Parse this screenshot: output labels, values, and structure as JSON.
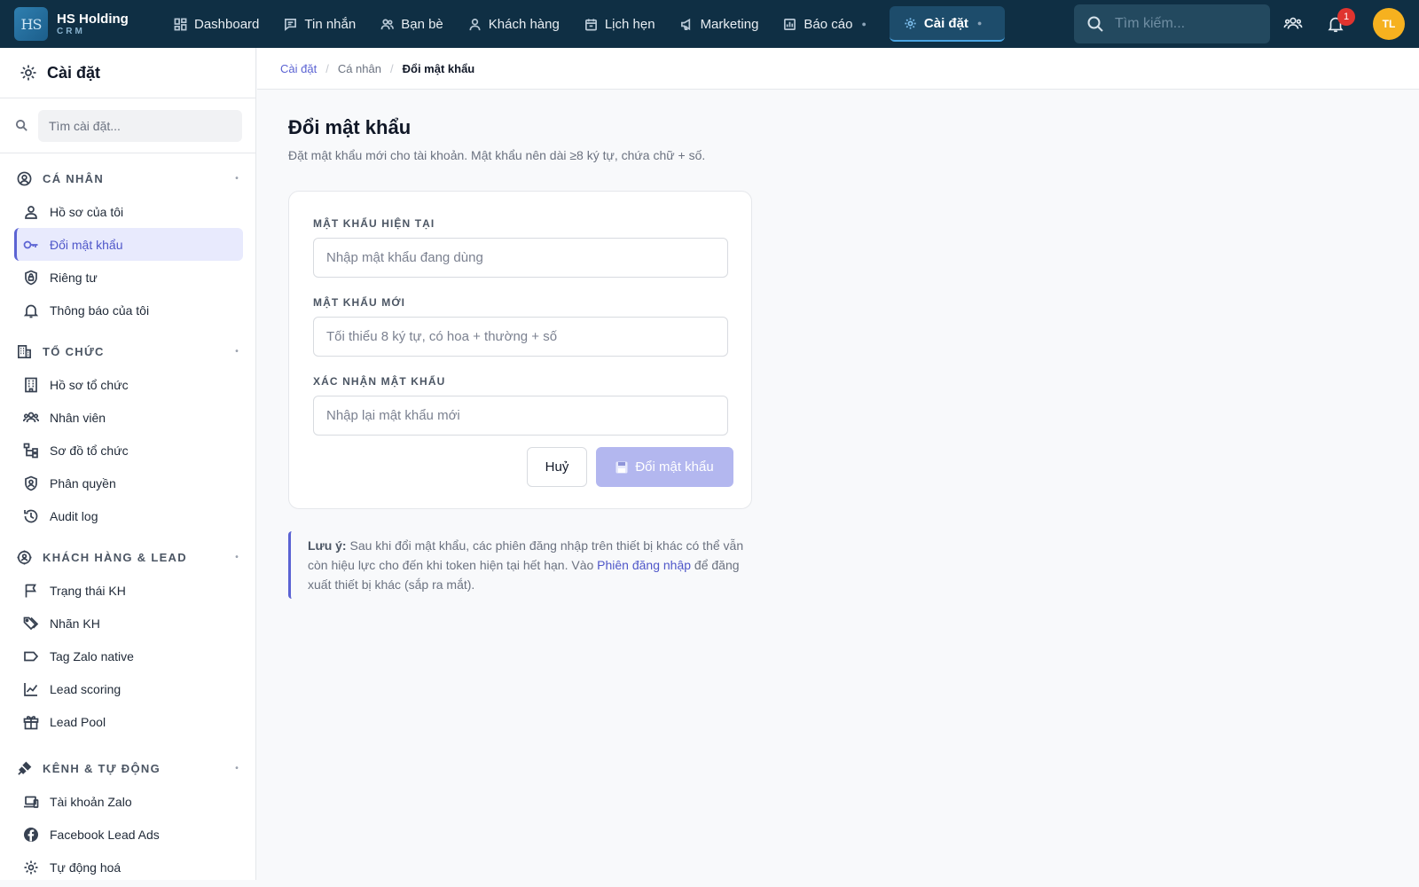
{
  "brand": {
    "logo": "HS",
    "name": "HS Holding",
    "sub": "CRM"
  },
  "nav": [
    {
      "label": "Dashboard",
      "icon": "dashboard-icon"
    },
    {
      "label": "Tin nhắn",
      "icon": "message-icon"
    },
    {
      "label": "Bạn bè",
      "icon": "friends-icon"
    },
    {
      "label": "Khách hàng",
      "icon": "customer-icon"
    },
    {
      "label": "Lịch hẹn",
      "icon": "calendar-icon"
    },
    {
      "label": "Marketing",
      "icon": "megaphone-icon"
    },
    {
      "label": "Báo cáo",
      "icon": "report-icon"
    },
    {
      "label": "Cài đặt",
      "icon": "gear-icon",
      "active": true
    }
  ],
  "search": {
    "placeholder": "Tìm kiếm..."
  },
  "notifications": {
    "count": "1"
  },
  "user": {
    "initials": "TL"
  },
  "colors": {
    "topbar": "#0f2f44",
    "accent": "#5b63d3",
    "avatar": "#f6b11f",
    "badge": "#e0342f"
  },
  "sidebar": {
    "title": "Cài đặt",
    "search_placeholder": "Tìm cài đặt...",
    "groups": [
      {
        "title": "CÁ NHÂN",
        "items": [
          {
            "label": "Hồ sơ của tôi"
          },
          {
            "label": "Đổi mật khẩu",
            "active": true
          },
          {
            "label": "Riêng tư"
          },
          {
            "label": "Thông báo của tôi"
          }
        ]
      },
      {
        "title": "TỔ CHỨC",
        "items": [
          {
            "label": "Hồ sơ tổ chức"
          },
          {
            "label": "Nhân viên"
          },
          {
            "label": "Sơ đồ tổ chức"
          },
          {
            "label": "Phân quyền"
          },
          {
            "label": "Audit log"
          }
        ]
      },
      {
        "title": "KHÁCH HÀNG & LEAD",
        "items": [
          {
            "label": "Trạng thái KH"
          },
          {
            "label": "Nhãn KH"
          },
          {
            "label": "Tag Zalo native"
          },
          {
            "label": "Lead scoring"
          },
          {
            "label": "Lead Pool"
          }
        ]
      },
      {
        "title": "KÊNH & TỰ ĐỘNG",
        "items": [
          {
            "label": "Tài khoản Zalo"
          },
          {
            "label": "Facebook Lead Ads"
          },
          {
            "label": "Tự động hoá"
          }
        ]
      }
    ]
  },
  "breadcrumb": {
    "root": "Cài đặt",
    "section": "Cá nhân",
    "current": "Đổi mật khẩu"
  },
  "page": {
    "title": "Đổi mật khẩu",
    "description": "Đặt mật khẩu mới cho tài khoản. Mật khẩu nên dài ≥8 ký tự, chứa chữ + số."
  },
  "form": {
    "current_label": "MẬT KHẨU HIỆN TẠI",
    "current_placeholder": "Nhập mật khẩu đang dùng",
    "new_label": "MẬT KHẨU MỚI",
    "new_placeholder": "Tối thiểu 8 ký tự, có hoa + thường + số",
    "confirm_label": "XÁC NHẬN MẬT KHẨU",
    "confirm_placeholder": "Nhập lại mật khẩu mới",
    "cancel_label": "Huỷ",
    "submit_label": "Đổi mật khẩu"
  },
  "note": {
    "prefix": "Lưu ý:",
    "text_before": " Sau khi đổi mật khẩu, các phiên đăng nhập trên thiết bị khác có thể vẫn còn hiệu lực cho đến khi token hiện tại hết hạn. Vào ",
    "link": "Phiên đăng nhập",
    "text_after": " để đăng xuất thiết bị khác (sắp ra mắt)."
  }
}
